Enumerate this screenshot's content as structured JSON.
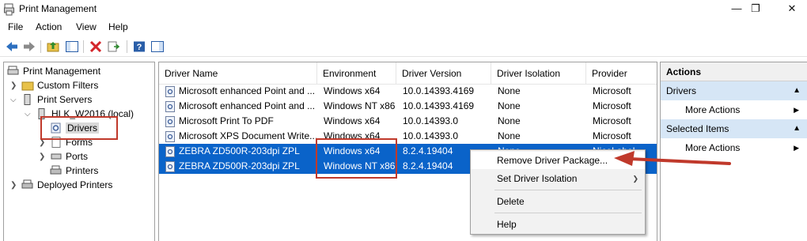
{
  "window": {
    "title": "Print Management",
    "minimize": "—",
    "restore": "❐",
    "close": "✕"
  },
  "menu": [
    "File",
    "Action",
    "View",
    "Help"
  ],
  "tree": {
    "root": "Print Management",
    "custom_filters": "Custom Filters",
    "print_servers": "Print Servers",
    "server": "HLK_W2016 (local)",
    "drivers": "Drivers",
    "forms": "Forms",
    "ports": "Ports",
    "printers": "Printers",
    "deployed": "Deployed Printers"
  },
  "columns": [
    "Driver Name",
    "Environment",
    "Driver Version",
    "Driver Isolation",
    "Provider"
  ],
  "rows": [
    {
      "name": "Microsoft enhanced Point and ...",
      "env": "Windows x64",
      "version": "10.0.14393.4169",
      "isolation": "None",
      "provider": "Microsoft"
    },
    {
      "name": "Microsoft enhanced Point and ...",
      "env": "Windows NT x86",
      "version": "10.0.14393.4169",
      "isolation": "None",
      "provider": "Microsoft"
    },
    {
      "name": "Microsoft Print To PDF",
      "env": "Windows x64",
      "version": "10.0.14393.0",
      "isolation": "None",
      "provider": "Microsoft"
    },
    {
      "name": "Microsoft XPS Document Write...",
      "env": "Windows x64",
      "version": "10.0.14393.0",
      "isolation": "None",
      "provider": "Microsoft"
    },
    {
      "name": "ZEBRA ZD500R-203dpi ZPL",
      "env": "Windows x64",
      "version": "8.2.4.19404",
      "isolation": "None",
      "provider": "NiceLabel"
    },
    {
      "name": "ZEBRA ZD500R-203dpi ZPL",
      "env": "Windows NT x86",
      "version": "8.2.4.19404",
      "isolation": "",
      "provider": ""
    }
  ],
  "actions": {
    "header": "Actions",
    "section1": "Drivers",
    "more1": "More Actions",
    "section2": "Selected Items",
    "more2": "More Actions"
  },
  "context_menu": {
    "remove": "Remove Driver Package...",
    "isolation": "Set Driver Isolation",
    "delete": "Delete",
    "help": "Help"
  },
  "colors": {
    "selection": "#0a63c9",
    "annotation": "#c0392b",
    "actions_section": "#d6e6f6"
  }
}
